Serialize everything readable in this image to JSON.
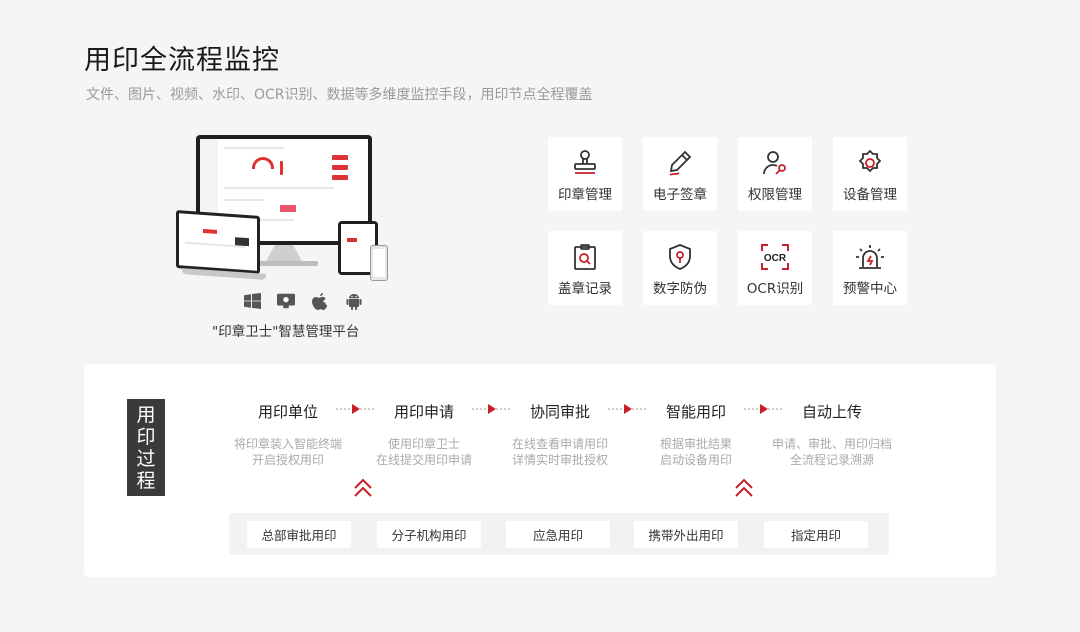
{
  "header": {
    "title": "用印全流程监控",
    "subtitle": "文件、图片、视频、水印、OCR识别、数据等多维度监控手段，用印节点全程覆盖"
  },
  "platform": {
    "label": "\"印章卫士\"智慧管理平台",
    "os_icons": [
      "windows-icon",
      "mac-finder-icon",
      "apple-icon",
      "android-icon"
    ]
  },
  "features": [
    {
      "label": "印章管理",
      "icon": "stamp-icon"
    },
    {
      "label": "电子签章",
      "icon": "pen-icon"
    },
    {
      "label": "权限管理",
      "icon": "user-key-icon"
    },
    {
      "label": "设备管理",
      "icon": "gear-icon"
    },
    {
      "label": "盖章记录",
      "icon": "clipboard-search-icon"
    },
    {
      "label": "数字防伪",
      "icon": "shield-icon"
    },
    {
      "label": "OCR识别",
      "icon": "ocr-scan-icon"
    },
    {
      "label": "预警中心",
      "icon": "alarm-icon"
    }
  ],
  "process": {
    "vertical_label": [
      "用",
      "印",
      "过",
      "程"
    ],
    "steps": [
      {
        "title": "用印单位",
        "desc1": "将印章装入智能终端",
        "desc2": "开启授权用印"
      },
      {
        "title": "用印申请",
        "desc1": "使用印章卫士",
        "desc2": "在线提交用印申请"
      },
      {
        "title": "协同审批",
        "desc1": "在线查看申请用印",
        "desc2": "详情实时审批授权"
      },
      {
        "title": "智能用印",
        "desc1": "根据审批结果",
        "desc2": "启动设备用印"
      },
      {
        "title": "自动上传",
        "desc1": "申请、审批、用印归档",
        "desc2": "全流程记录溯源"
      }
    ],
    "options": [
      "总部审批用印",
      "分子机构用印",
      "应急用印",
      "携带外出用印",
      "指定用印"
    ]
  },
  "colors": {
    "accent": "#c8202a",
    "dark": "#3a3a3a",
    "background": "#f5f5f5"
  }
}
